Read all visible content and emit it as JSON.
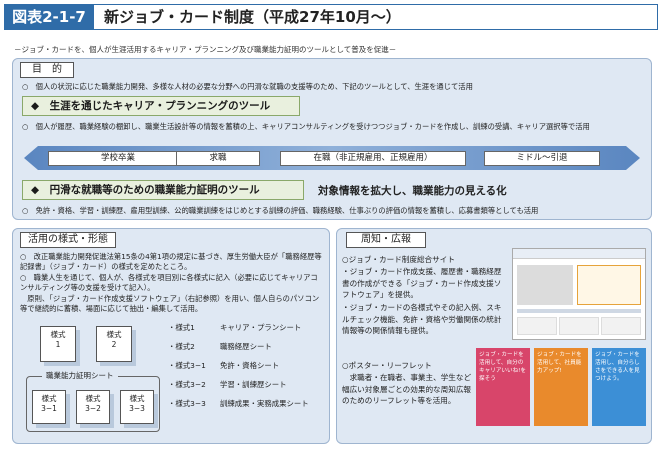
{
  "header": {
    "figure_label": "図表2-1-7",
    "title": "新ジョブ・カード制度（平成27年10月〜）"
  },
  "subtitle": "－ジョブ・カードを、個人が生涯活用するキャリア・プランニング及び職業能力証明のツールとして普及を促進－",
  "purpose": {
    "tag": "目　的",
    "text": "○　個人の状況に応じた職業能力開発、多様な人材の必要な分野への円滑な就職の支援等のため、下記のツールとして、生涯を通じて活用"
  },
  "section1": {
    "title": "◆　生涯を通じたキャリア・プランニングのツール",
    "text": "○　個人が履歴、職業経験の棚卸し、職業生活設計等の情報を蓄積の上、キャリアコンサルティングを受けつつジョブ・カードを作成し、訓練の受講、キャリア選択等で活用"
  },
  "stages": [
    "学校卒業",
    "求職",
    "在職（非正規雇用、正規雇用）",
    "ミドル〜引退"
  ],
  "section2": {
    "title": "◆　円滑な就職等のための職業能力証明のツール",
    "side_text": "対象情報を拡大し、職業能力の見える化",
    "text": "○　免許・資格、学習・訓練歴、雇用型訓練、公的職業訓練をはじめとする訓練の評価、職務経験、仕事ぶりの評価の情報を蓄積し、応募書類等としても活用"
  },
  "left_panel": {
    "tag": "活用の様式・形態",
    "para1": "○　改正職業能力開発促進法第15条の4第1項の規定に基づき、厚生労働大臣が「職務経歴等記録書」（ジョブ・カード）の様式を定めたところ。",
    "para2": "○　職業人生を通じて、個人が、各様式を項目別に各様式に記入（必要に応じてキャリアコンサルティング等の支援を受けて記入）。",
    "para3": "　原則、「ジョブ・カード作成支援ソフトウェア」（右記参照）を用い、個人自らのパソコン等で継続的に蓄積、場面に応じて抽出・編集して活用。",
    "doc1": "様式\n1",
    "doc2": "様式\n2",
    "cert_label": "職業能力証明シート",
    "doc31": "様式\n3−1",
    "doc32": "様式\n3−2",
    "doc33": "様式\n3−3",
    "forms": [
      {
        "name": "・様式1",
        "desc": "キャリア・プランシート"
      },
      {
        "name": "・様式2",
        "desc": "職務経歴シート"
      },
      {
        "name": "・様式3−1",
        "desc": "免許・資格シート"
      },
      {
        "name": "・様式3−2",
        "desc": "学習・訓練歴シート"
      },
      {
        "name": "・様式3−3",
        "desc": "訓練成果・実務成果シート"
      }
    ]
  },
  "right_panel": {
    "tag": "周知・広報",
    "site_title": "○ジョブ・カード制度総合サイト",
    "site_p1": "・ジョブ・カード作成支援、履歴書・職務経歴書の作成ができる「ジョブ・カード作成支援ソフトウェア」を提供。",
    "site_p2": "・ジョブ・カードの各様式やその記入例、スキルチェック機能、免許・資格や労働関係の統計情報等の関係情報も提供。",
    "poster_title": "○ポスター・リーフレット",
    "poster_text": "　求職者・在職者、事業主、学生など幅広い対象層ごとの効果的な周知広報のためのリーフレット等を活用。",
    "flyer1": "ジョブ・カードを活用して、自分のキャリアいいね!を探そう",
    "flyer2": "ジョブ・カードを活用して、社員能力アップ!",
    "flyer3": "ジョブ・カードを活用し、自分らしさをできる人を見つけよう。",
    "colors": {
      "flyer1": "#d8456a",
      "flyer2": "#e98a2c",
      "flyer3": "#3c8fd6"
    }
  },
  "colors": {
    "accent": "#2f6ca8",
    "panel_bg": "#dfe8f3",
    "section_bg": "#e9f0de"
  }
}
